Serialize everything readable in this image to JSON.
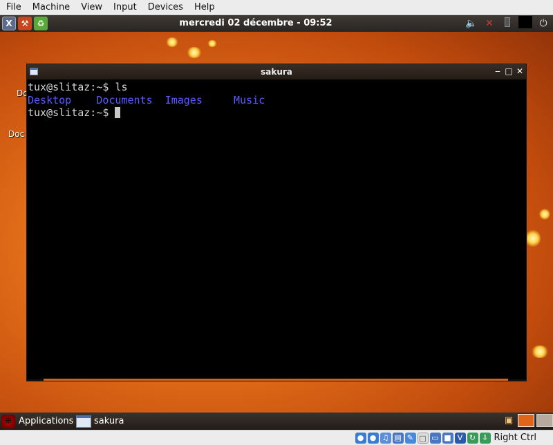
{
  "host_menu": {
    "items": [
      "File",
      "Machine",
      "View",
      "Input",
      "Devices",
      "Help"
    ]
  },
  "top_panel": {
    "clock": "mercredi 02 décembre - 09:52",
    "launchers": [
      "xterm-icon",
      "wrench-icon",
      "recycle-icon"
    ],
    "tray": [
      "volume-icon",
      "network-disconnected-icon",
      "battery-icon",
      "keyboard-indicator-icon",
      "power-icon"
    ]
  },
  "desktop": {
    "icon_labels": [
      "Do",
      "Doc"
    ]
  },
  "terminal": {
    "title": "sakura",
    "lines": [
      {
        "prompt": "tux@slitaz:~$ ",
        "command": "ls"
      }
    ],
    "ls_output": [
      "Desktop",
      "Documents",
      "Images",
      "Music"
    ],
    "current_prompt": "tux@slitaz:~$ "
  },
  "taskbar": {
    "applications_label": "Applications",
    "tasks": [
      {
        "label": "sakura"
      }
    ]
  },
  "statusbar": {
    "host_key": "Right Ctrl"
  }
}
